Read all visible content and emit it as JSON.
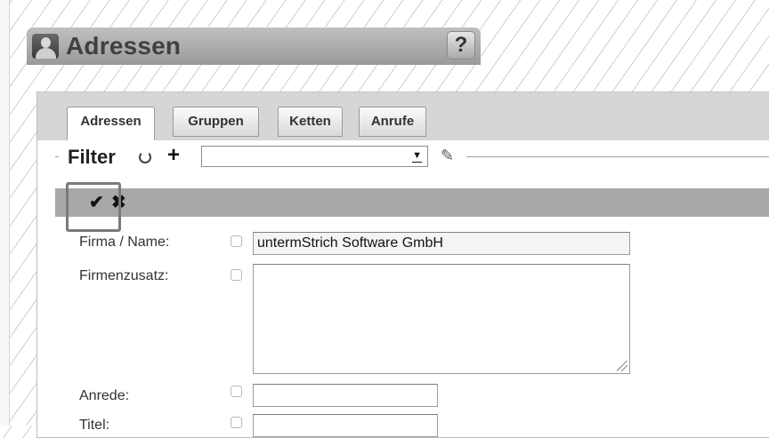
{
  "header": {
    "title": "Adressen",
    "help_label": "?"
  },
  "tabs": [
    {
      "label": "Adressen",
      "active": true
    },
    {
      "label": "Gruppen",
      "active": false
    },
    {
      "label": "Ketten",
      "active": false
    },
    {
      "label": "Anrufe",
      "active": false
    }
  ],
  "filter": {
    "label": "Filter",
    "select_value": ""
  },
  "toolbar": {
    "save_icon": "check-icon",
    "cancel_icon": "x-icon"
  },
  "form": {
    "fields": [
      {
        "label": "Firma / Name:",
        "value": "untermStrich Software GmbH"
      },
      {
        "label": "Firmenzusatz:",
        "value": ""
      },
      {
        "label": "Anrede:",
        "value": ""
      },
      {
        "label": "Titel:",
        "value": ""
      }
    ]
  },
  "colors": {
    "header_bar": "#a9a9a9",
    "toolbar": "#a8a8a8",
    "tabstrip": "#d6d6d6",
    "highlight_border": "#7a7a7a"
  }
}
